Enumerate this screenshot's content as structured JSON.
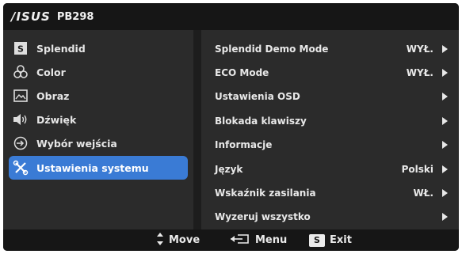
{
  "header": {
    "brand": "/ISUS",
    "model": "PB298"
  },
  "left_menu": [
    {
      "label": "Splendid",
      "icon": "splendid-s-icon"
    },
    {
      "label": "Color",
      "icon": "color-circles-icon"
    },
    {
      "label": "Obraz",
      "icon": "image-icon"
    },
    {
      "label": "Dźwięk",
      "icon": "speaker-icon"
    },
    {
      "label": "Wybór wejścia",
      "icon": "input-arrow-icon"
    },
    {
      "label": "Ustawienia systemu",
      "icon": "tools-icon",
      "selected": true
    }
  ],
  "right_menu": [
    {
      "label": "Splendid Demo Mode",
      "value": "WYŁ."
    },
    {
      "label": "ECO Mode",
      "value": "WYŁ."
    },
    {
      "label": "Ustawienia OSD",
      "value": ""
    },
    {
      "label": "Blokada klawiszy",
      "value": ""
    },
    {
      "label": "Informacje",
      "value": ""
    },
    {
      "label": "Język",
      "value": "Polski"
    },
    {
      "label": "Wskaźnik zasilania",
      "value": "WŁ."
    },
    {
      "label": "Wyzeruj wszystko",
      "value": ""
    }
  ],
  "footer": {
    "move": "Move",
    "menu": "Menu",
    "exit_key": "S",
    "exit": "Exit"
  },
  "colors": {
    "accent": "#3a7bd5",
    "panel": "#2b2b2b",
    "bar": "#161616"
  }
}
